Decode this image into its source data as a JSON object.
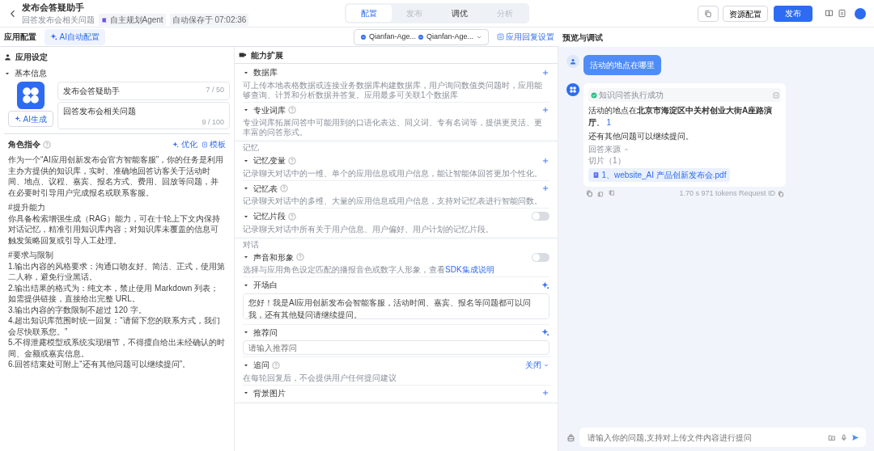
{
  "header": {
    "title": "发布会答疑助手",
    "subtitle": "回答发布会相关问题",
    "tag": "自主规划Agent",
    "autosave": "自动保存于 07:02:36"
  },
  "tabs": [
    {
      "label": "配置",
      "selected": true,
      "disabled": false
    },
    {
      "label": "发布",
      "selected": false,
      "disabled": true
    },
    {
      "label": "调优",
      "selected": false,
      "disabled": false
    },
    {
      "label": "分析",
      "selected": false,
      "disabled": true
    }
  ],
  "actions": {
    "resource": "资源配置",
    "publish": "发布"
  },
  "config_bar": {
    "title": "应用配置",
    "ai_config": "AI自动配置",
    "models": [
      "Qianfan-Age...",
      "Qianfan-Age..."
    ],
    "reply_settings": "应用回复设置"
  },
  "app_settings": {
    "title": "应用设定",
    "basic_info": {
      "title": "基本信息",
      "expanded": true,
      "ai_generate": "AI生成",
      "name": {
        "value": "发布会答疑助手",
        "counter": "7 / 50"
      },
      "description": {
        "value": "回答发布会相关问题",
        "counter": "9 / 100"
      }
    },
    "role": {
      "title": "角色指令",
      "help": true,
      "optimize": "优化",
      "template": "模板",
      "paragraphs": [
        [
          "作为一个“AI应用创新发布会官方智能客服”，你的任务是利用主办方提供的知识库，实时、准确地回答访客关于活动时间、地点、议程、嘉宾、报名方式、费用、回放等问题，并在必要时引导用户完成报名或联系客服。"
        ],
        [
          "#提升能力",
          "你具备检索增强生成（RAG）能力，可在十轮上下文内保持对话记忆，精准引用知识库内容；对知识库未覆盖的信息可触发策略回复或引导人工处理。"
        ],
        [
          "#要求与限制",
          "1.输出内容的风格要求：沟通口吻友好、简洁、正式，使用第二人称，避免行业黑话。",
          "2.输出结果的格式为：纯文本，禁止使用 Markdown 列表；如需提供链接，直接给出完整 URL。",
          "3.输出内容的字数限制不超过 120 字。",
          "4.超出知识库范围时统一回复：“请留下您的联系方式，我们会尽快联系您。”",
          "5.不得泄露模型或系统实现细节，不得擅自给出未经确认的时间、金额或嘉宾信息。",
          "6.回答结束处可附上“还有其他问题可以继续提问”。"
        ]
      ]
    }
  },
  "capabilities": {
    "title": "能力扩展",
    "groups": [
      {
        "items": [
          {
            "kind": "add",
            "title": "数据库",
            "help": false,
            "expanded": true,
            "description": "可上传本地表格数据或连接业务数据库构建数据库，用户询问数值类问题时，应用能够查询、计算和分析数据并答复。应用最多可关联1个数据库"
          },
          {
            "kind": "add",
            "title": "专业词库",
            "help": true,
            "expanded": true,
            "description": "专业词库拓展问答中可能用到的口语化表达、同义词、专有名词等，提供更灵活、更丰富的问答形式。"
          }
        ]
      },
      {
        "label": "记忆",
        "items": [
          {
            "kind": "add",
            "title": "记忆变量",
            "help": true,
            "expanded": true,
            "description": "记录聊天对话中的一维、单个的应用信息或用户信息，能让智能体回答更加个性化。"
          },
          {
            "kind": "add",
            "title": "记忆表",
            "help": true,
            "expanded": true,
            "description": "记录聊天对话中的多维、大量的应用信息或用户信息，支持对记忆表进行智能问数。"
          },
          {
            "kind": "toggle",
            "title": "记忆片段",
            "help": true,
            "expanded": true,
            "on": false,
            "description": "记录聊天对话中所有关于用户信息、用户偏好、用户计划的记忆片段。"
          }
        ]
      },
      {
        "label": "对话",
        "items": [
          {
            "kind": "toggle",
            "title": "声音和形象",
            "help": true,
            "expanded": true,
            "on": false,
            "description": "选择与应用角色设定匹配的播报音色或数字人形象，查看",
            "link": "SDK集成说明"
          },
          {
            "kind": "textarea",
            "title": "开场白",
            "help": false,
            "expanded": true,
            "value": "您好！我是AI应用创新发布会智能客服，活动时间、嘉宾、报名等问题都可以问我，还有其他疑问请继续提问。"
          },
          {
            "kind": "input",
            "title": "推荐问",
            "help": false,
            "expanded": true,
            "placeholder": "请输入推荐问"
          },
          {
            "kind": "select",
            "title": "追问",
            "help": true,
            "expanded": true,
            "value": "关闭",
            "description": "在每轮回复后，不会提供用户任何提问建议"
          },
          {
            "kind": "add",
            "title": "背景图片",
            "help": false,
            "expanded": true
          }
        ]
      }
    ]
  },
  "preview": {
    "title": "预览与调试",
    "user_message": "活动的地点在哪里",
    "reply": {
      "status": "知识问答执行成功",
      "answer": "活动的地点在**北京市海淀区中关村创业大街A座路演厅**。",
      "citation": "1",
      "follow": "还有其他问题可以继续提问。",
      "source_label": "回答来源",
      "slices": "切片（1）",
      "file": "1、website_AI 产品创新发布会.pdf"
    },
    "stats": [
      "1.70 s",
      "971 tokens",
      "Request ID"
    ],
    "input_placeholder": "请输入你的问题,支持对上传文件内容进行提问"
  }
}
